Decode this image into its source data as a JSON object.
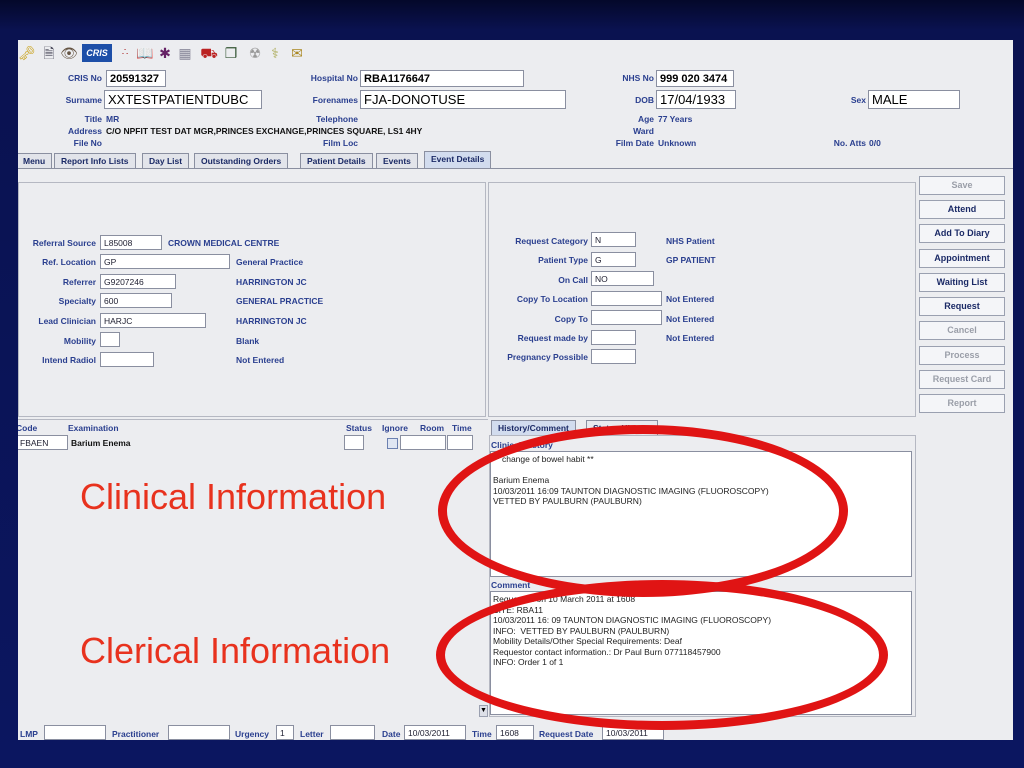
{
  "header": {
    "crisNo": {
      "label": "CRIS No",
      "value": "20591327"
    },
    "hospitalNo": {
      "label": "Hospital No",
      "value": "RBA1176647"
    },
    "nhsNo": {
      "label": "NHS No",
      "value": "999 020 3474"
    },
    "surname": {
      "label": "Surname",
      "value": "XXTESTPATIENTDUBC"
    },
    "forenames": {
      "label": "Forenames",
      "value": "FJA-DONOTUSE"
    },
    "dob": {
      "label": "DOB",
      "value": "17/04/1933"
    },
    "sex": {
      "label": "Sex",
      "value": "MALE"
    },
    "title": {
      "label": "Title",
      "value": "MR"
    },
    "telephone": {
      "label": "Telephone",
      "value": ""
    },
    "age": {
      "label": "Age",
      "value": "77 Years"
    },
    "address": {
      "label": "Address",
      "value": "C/O NPFIT TEST DAT MGR,PRINCES EXCHANGE,PRINCES SQUARE, LS1 4HY"
    },
    "ward": {
      "label": "Ward",
      "value": ""
    },
    "fileNo": {
      "label": "File No",
      "value": ""
    },
    "filmLoc": {
      "label": "Film Loc",
      "value": ""
    },
    "filmDate": {
      "label": "Film Date",
      "value": "Unknown"
    },
    "noAtts": {
      "label": "No. Atts",
      "value": "0/0"
    }
  },
  "tabs": [
    "Menu",
    "Report Info Lists",
    "Day List",
    "Outstanding Orders",
    "Patient Details",
    "Events",
    "Event Details"
  ],
  "referral": {
    "referralSource": {
      "label": "Referral Source",
      "value": "L85008",
      "desc": "CROWN MEDICAL CENTRE"
    },
    "refLocation": {
      "label": "Ref. Location",
      "value": "GP",
      "desc": "General Practice"
    },
    "referrer": {
      "label": "Referrer",
      "value": "G9207246",
      "desc": "HARRINGTON JC"
    },
    "specialty": {
      "label": "Specialty",
      "value": "600",
      "desc": "GENERAL PRACTICE"
    },
    "leadClinician": {
      "label": "Lead Clinician",
      "value": "HARJC",
      "desc": "HARRINGTON JC"
    },
    "mobility": {
      "label": "Mobility",
      "value": "",
      "desc": "Blank"
    },
    "intendRadiol": {
      "label": "Intend Radiol",
      "value": "",
      "desc": "Not Entered"
    }
  },
  "request": {
    "requestCategory": {
      "label": "Request Category",
      "value": "N",
      "desc": "NHS Patient"
    },
    "patientType": {
      "label": "Patient Type",
      "value": "G",
      "desc": "GP PATIENT"
    },
    "onCall": {
      "label": "On Call",
      "value": "NO"
    },
    "copyToLocation": {
      "label": "Copy To Location",
      "value": "",
      "desc": "Not Entered"
    },
    "copyTo": {
      "label": "Copy To",
      "value": "",
      "desc": "Not Entered"
    },
    "requestMadeBy": {
      "label": "Request made by",
      "value": "",
      "desc": "Not Entered"
    },
    "pregnancyPossible": {
      "label": "Pregnancy Possible",
      "value": ""
    }
  },
  "sideButtons": [
    {
      "label": "Save",
      "enabled": false
    },
    {
      "label": "Attend",
      "enabled": true
    },
    {
      "label": "Add To Diary",
      "enabled": true
    },
    {
      "label": "Appointment",
      "enabled": true
    },
    {
      "label": "Waiting List",
      "enabled": true
    },
    {
      "label": "Request",
      "enabled": true
    },
    {
      "label": "Cancel",
      "enabled": false
    },
    {
      "label": "Process",
      "enabled": false
    },
    {
      "label": "Request Card",
      "enabled": false
    },
    {
      "label": "Report",
      "enabled": false
    }
  ],
  "exam": {
    "headers": {
      "code": "Code",
      "examination": "Examination",
      "status": "Status",
      "ignore": "Ignore",
      "room": "Room",
      "time": "Time"
    },
    "row": {
      "code": "FBAEN",
      "examination": "Barium Enema"
    }
  },
  "history": {
    "tabs": [
      "History/Comment",
      "Status History"
    ],
    "clinicalLabel": "Clinical History",
    "clinicalText": "** change of bowel habit **\n\nBarium Enema\n10/03/2011 16:09 TAUNTON DIAGNOSTIC IMAGING (FLUOROSCOPY)\nVETTED BY PAULBURN (PAULBURN)",
    "commentLabel": "Comment",
    "commentText": "Requested on 10 March 2011 at 1608\nSITE: RBA11\n10/03/2011 16: 09 TAUNTON DIAGNOSTIC IMAGING (FLUOROSCOPY)\nINFO:  VETTED BY PAULBURN (PAULBURN)\nMobility Details/Other Special Requirements: Deaf\nRequestor contact information.: Dr Paul Burn 077118457900\nINFO: Order 1 of 1"
  },
  "bottom": {
    "lmp": {
      "label": "LMP",
      "value": ""
    },
    "practitioner": {
      "label": "Practitioner",
      "value": ""
    },
    "urgency": {
      "label": "Urgency",
      "value": "1"
    },
    "letter": {
      "label": "Letter",
      "value": ""
    },
    "date": {
      "label": "Date",
      "value": "10/03/2011"
    },
    "time": {
      "label": "Time",
      "value": "1608"
    },
    "requestDate": {
      "label": "Request Date",
      "value": "10/03/2011"
    }
  },
  "annotations": {
    "clinical": "Clinical Information",
    "clerical": "Clerical Information"
  },
  "colors": {
    "annotationText": "#e8321e",
    "ellipse": "#e01414",
    "label": "#2a3f8f"
  }
}
